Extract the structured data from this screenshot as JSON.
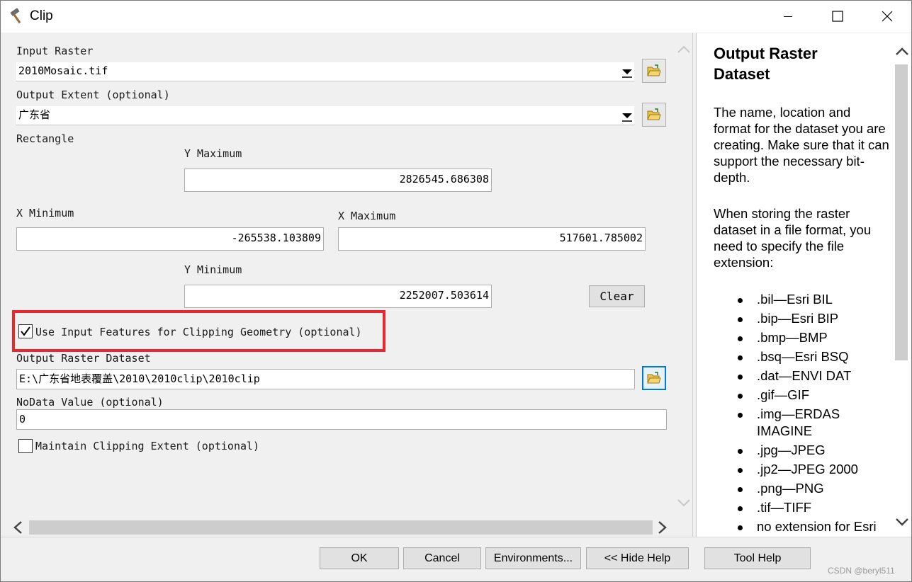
{
  "window": {
    "title": "Clip",
    "icon": "hammer-icon"
  },
  "form": {
    "input_raster_label": "Input Raster",
    "input_raster_value": "2010Mosaic.tif",
    "output_extent_label": "Output Extent (optional)",
    "output_extent_value": "广东省",
    "rectangle_label": "Rectangle",
    "y_max_label": "Y Maximum",
    "y_max_value": "2826545.686308",
    "x_min_label": "X Minimum",
    "x_min_value": "-265538.103809",
    "x_max_label": "X Maximum",
    "x_max_value": "517601.785002",
    "y_min_label": "Y Minimum",
    "y_min_value": "2252007.503614",
    "clear_label": "Clear",
    "use_input_features_label": "Use Input Features for Clipping Geometry (optional)",
    "use_input_features_checked": true,
    "output_raster_label": "Output Raster Dataset",
    "output_raster_value": "E:\\广东省地表覆盖\\2010\\2010clip\\2010clip",
    "nodata_label": "NoData Value (optional)",
    "nodata_value": "0",
    "maintain_extent_label": "Maintain Clipping Extent (optional)",
    "maintain_extent_checked": false
  },
  "help": {
    "title": "Output Raster Dataset",
    "paragraph1": "The name, location and format for the dataset you are creating. Make sure that it can support the necessary bit-depth.",
    "paragraph2": "When storing the raster dataset in a file format, you need to specify the file extension:",
    "formats": [
      ".bil—Esri BIL",
      ".bip—Esri BIP",
      ".bmp—BMP",
      ".bsq—Esri BSQ",
      ".dat—ENVI DAT",
      ".gif—GIF",
      ".img—ERDAS IMAGINE",
      ".jpg—JPEG",
      ".jp2—JPEG 2000",
      ".png—PNG",
      ".tif—TIFF",
      "no extension for Esri"
    ]
  },
  "buttons": {
    "ok": "OK",
    "cancel": "Cancel",
    "environments": "Environments...",
    "hide_help": "<< Hide Help",
    "tool_help": "Tool Help"
  },
  "watermark": "CSDN @beryl511"
}
